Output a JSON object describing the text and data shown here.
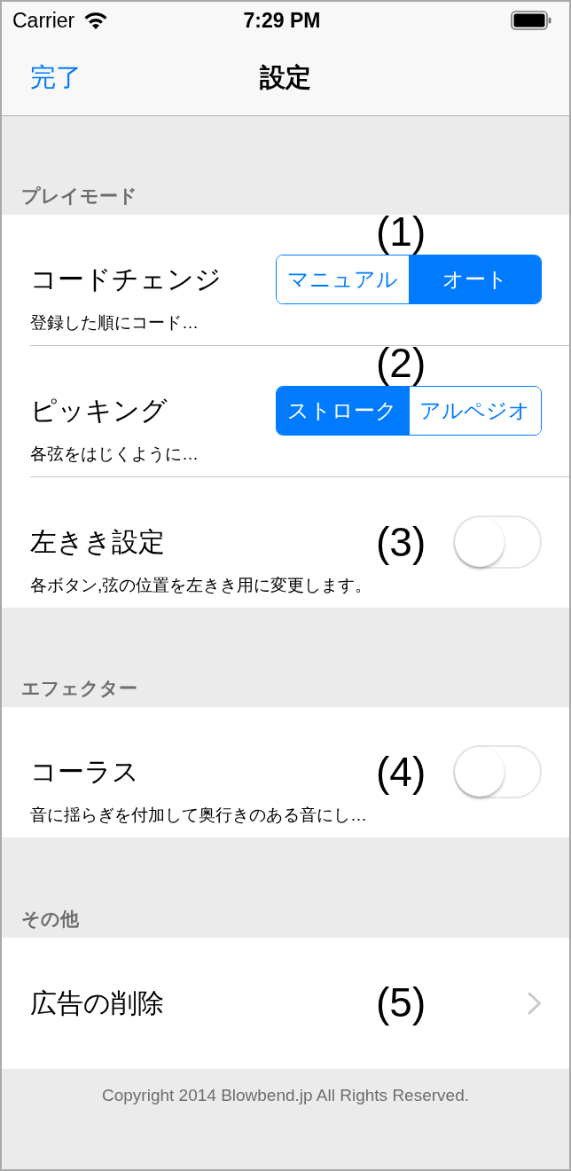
{
  "status_bar": {
    "carrier": "Carrier",
    "time": "7:29 PM"
  },
  "nav_bar": {
    "left_button": "完了",
    "title": "設定"
  },
  "sections": [
    {
      "header": "プレイモード",
      "rows": [
        {
          "kind": "segmented",
          "title": "コードチェンジ",
          "subtitle": "登録した順にコード…",
          "annotation": "(1)",
          "segments": [
            {
              "label": "マニュアル",
              "selected": false
            },
            {
              "label": "オート",
              "selected": true
            }
          ]
        },
        {
          "kind": "segmented",
          "title": "ピッキング",
          "subtitle": "各弦をはじくように…",
          "annotation": "(2)",
          "segments": [
            {
              "label": "ストローク",
              "selected": true
            },
            {
              "label": "アルペジオ",
              "selected": false
            }
          ]
        },
        {
          "kind": "switch",
          "title": "左きき設定",
          "subtitle": "各ボタン,弦の位置を左きき用に変更します。",
          "annotation": "(3)",
          "on": false
        }
      ]
    },
    {
      "header": "エフェクター",
      "rows": [
        {
          "kind": "switch",
          "title": "コーラス",
          "subtitle": "音に揺らぎを付加して奥行きのある音にし…",
          "annotation": "(4)",
          "on": false
        }
      ]
    },
    {
      "header": "その他",
      "rows": [
        {
          "kind": "disclosure",
          "title": "広告の削除",
          "annotation": "(5)"
        }
      ]
    }
  ],
  "footer": "Copyright 2014 Blowbend.jp All Rights Reserved."
}
